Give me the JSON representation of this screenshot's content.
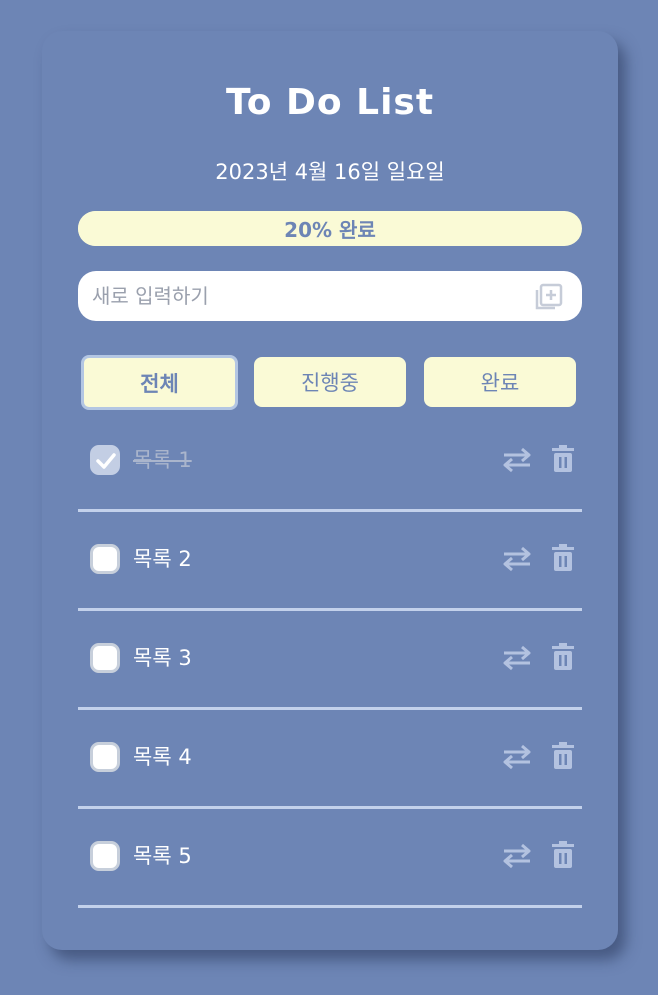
{
  "app": {
    "title": "To Do List",
    "date": "2023년 4월 16일  일요일"
  },
  "progress": {
    "percent": 20,
    "label": "20% 완료"
  },
  "input": {
    "placeholder": "새로 입력하기",
    "value": ""
  },
  "tabs": [
    {
      "label": "전체",
      "active": true
    },
    {
      "label": "진행중",
      "active": false
    },
    {
      "label": "완료",
      "active": false
    }
  ],
  "items": [
    {
      "label": "목록 1",
      "done": true
    },
    {
      "label": "목록 2",
      "done": false
    },
    {
      "label": "목록 3",
      "done": false
    },
    {
      "label": "목록 4",
      "done": false
    },
    {
      "label": "목록 5",
      "done": false
    }
  ],
  "icons": {
    "add": "add-box-icon",
    "swap": "swap-arrows-icon",
    "delete": "trash-icon",
    "check": "checkmark-icon"
  },
  "colors": {
    "background": "#6d85b5",
    "accent": "#fafad6",
    "divider": "#c3d1eb",
    "icon": "#b3c2e0"
  }
}
